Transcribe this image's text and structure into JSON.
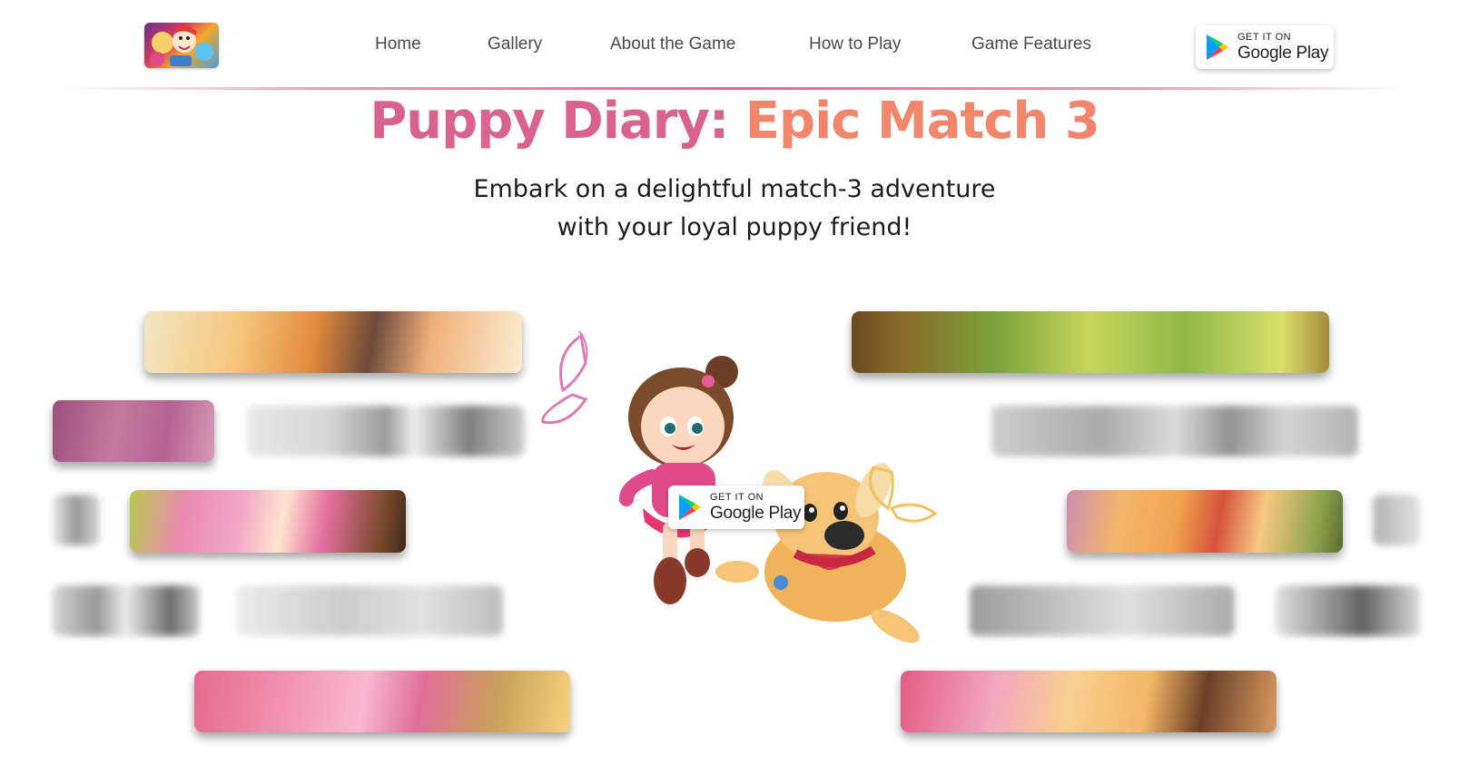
{
  "header": {
    "nav": [
      {
        "label": "Home"
      },
      {
        "label": "Gallery"
      },
      {
        "label": "About the Game"
      },
      {
        "label": "How to Play"
      },
      {
        "label": "Game Features"
      }
    ],
    "badge": {
      "small": "GET IT ON",
      "big": "Google Play"
    }
  },
  "hero": {
    "title_part1": "Puppy Diary:",
    "title_part2": "Epic Match 3",
    "subtitle_line1": "Embark on a delightful match-3 adventure",
    "subtitle_line2": "with your loyal puppy friend!",
    "badge": {
      "small": "GET IT ON",
      "big": "Google Play"
    }
  },
  "colors": {
    "title_pink": "#d9628f",
    "title_coral": "#f2856a",
    "divider": "#d86a97"
  },
  "icons": {
    "logo": "game-logo-icon",
    "store": "google-play-icon"
  }
}
